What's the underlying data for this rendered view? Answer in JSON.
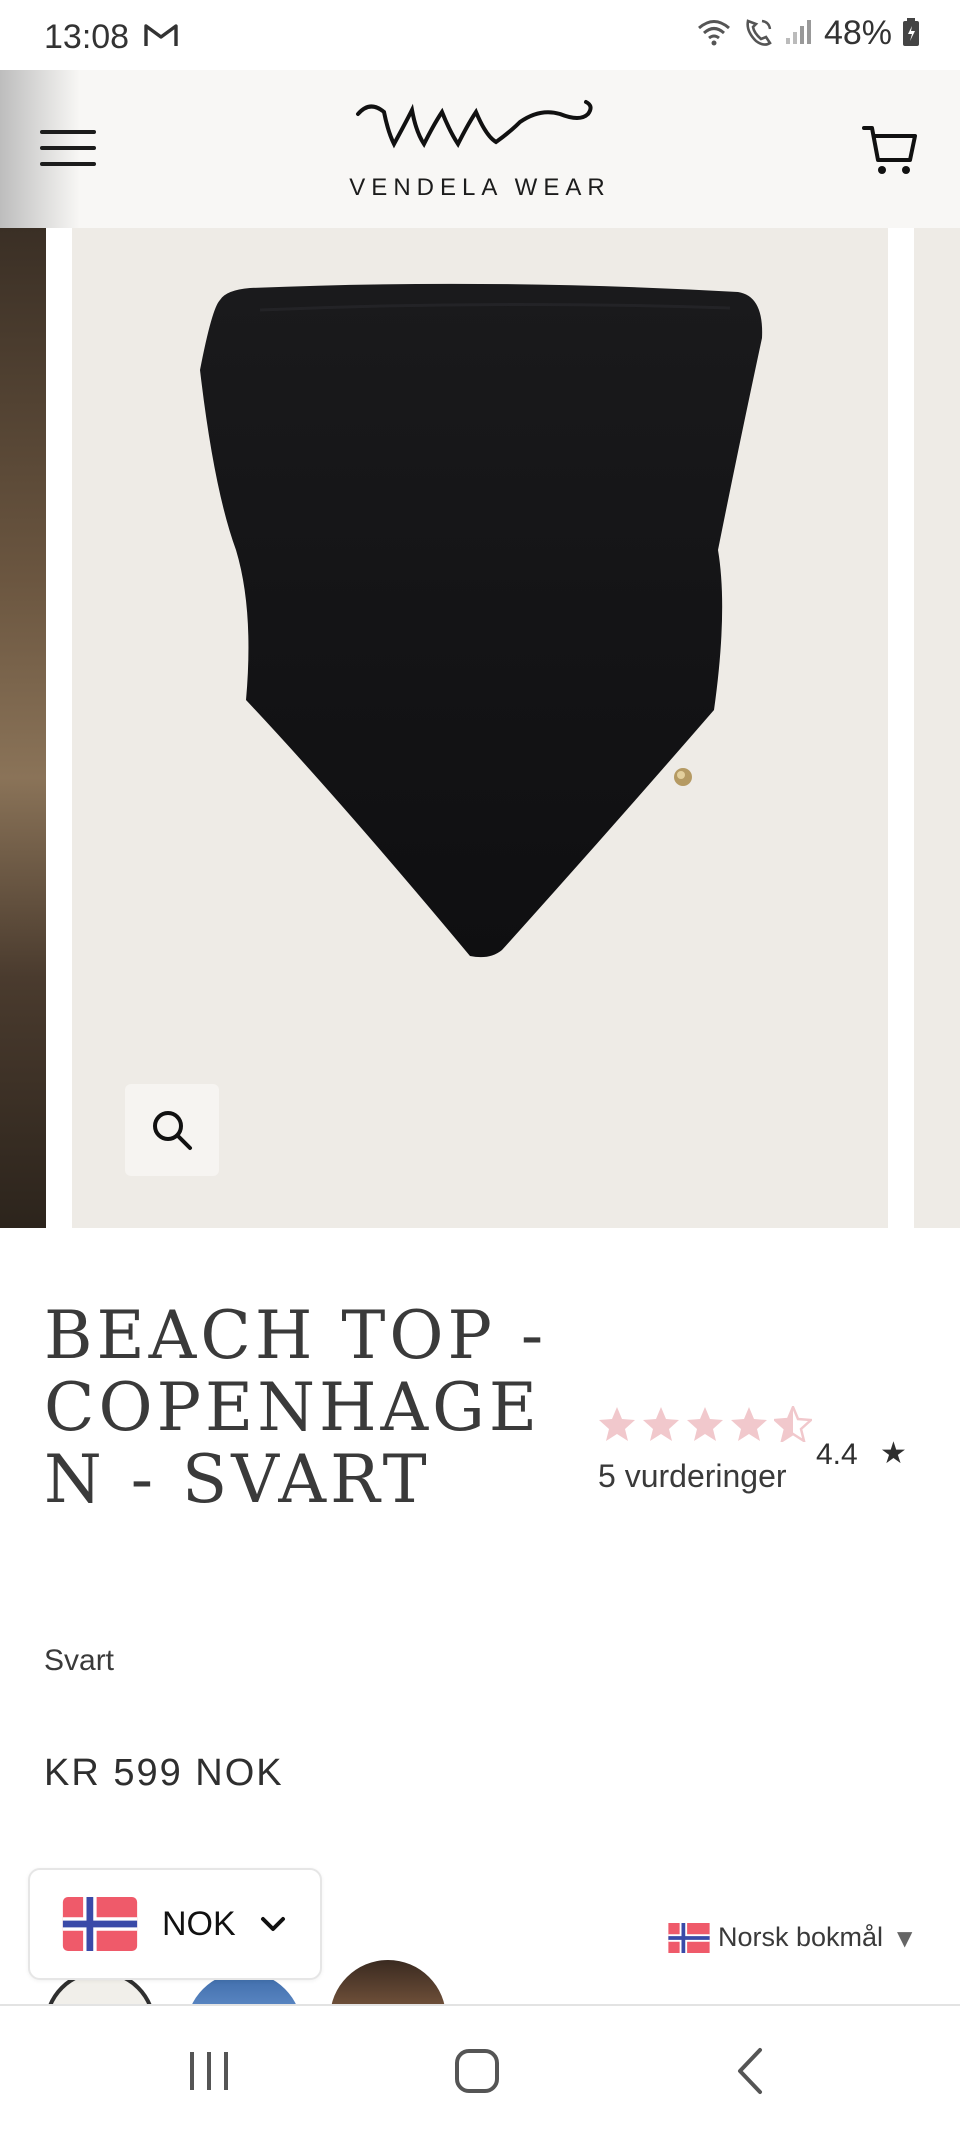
{
  "status_bar": {
    "time": "13:08",
    "battery_percent": "48%",
    "icons": [
      "gmail-icon",
      "wifi-icon",
      "wifi-calling-icon",
      "signal-icon",
      "battery-icon"
    ]
  },
  "header": {
    "brand_name": "VENDELA WEAR",
    "brand_monogram": "vw",
    "menu_icon": "hamburger-menu-icon",
    "cart_icon": "cart-icon"
  },
  "gallery": {
    "zoom_icon": "search-icon",
    "background_color": "#eeebe6"
  },
  "product": {
    "title": "BEACH TOP - COPENHAGEN - SVART",
    "variant": "Svart",
    "price": "KR 599 NOK",
    "rating": {
      "stars_filled": 4.4,
      "stars_total": 5,
      "count_label": "5 vurderinger",
      "score": "4.4",
      "score_star": "★",
      "star_color": "#f1c8cc"
    }
  },
  "currency_selector": {
    "code": "NOK",
    "flag_icon": "norway-flag-icon"
  },
  "language_selector": {
    "label": "Norsk bokmål",
    "caret": "▼",
    "flag_icon": "norway-flag-icon"
  },
  "nav_bar": {
    "icons": [
      "recent-apps-icon",
      "home-icon",
      "back-icon"
    ]
  }
}
